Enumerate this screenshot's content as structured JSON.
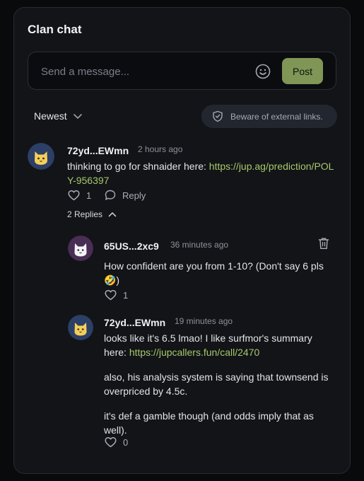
{
  "header": {
    "title": "Clan chat"
  },
  "composer": {
    "placeholder": "Send a message...",
    "post_label": "Post"
  },
  "sort": {
    "label": "Newest"
  },
  "warning": {
    "text": "Beware of external links."
  },
  "colors": {
    "accent": "#7f9657",
    "link": "#a7c86a"
  },
  "comment": {
    "author": "72yd...EWmn",
    "time": "2 hours ago",
    "text": "thinking to go for shnaider here: ",
    "link": "https://jup.ag/prediction/POLY-956397",
    "likes": "1",
    "reply_label": "Reply",
    "replies_label": "2 Replies"
  },
  "replies": [
    {
      "author": "65US...2xc9",
      "time": "36 minutes ago",
      "text": "How confident are you from 1-10? (Don't say 6 pls 🤣)",
      "likes": "1",
      "avatar": "white-cat-avatar"
    },
    {
      "author": "72yd...EWmn",
      "time": "19 minutes ago",
      "text_before": "looks like it's 6.5 lmao! I like surfmor's summary here: ",
      "link": "https://jupcallers.fun/call/2470",
      "para2": "also, his analysis system is saying that townsend is overpriced by 4.5c.",
      "para3": "it's def a gamble though (and odds imply that as well).",
      "likes": "0",
      "avatar": "yellow-cat-avatar"
    }
  ]
}
